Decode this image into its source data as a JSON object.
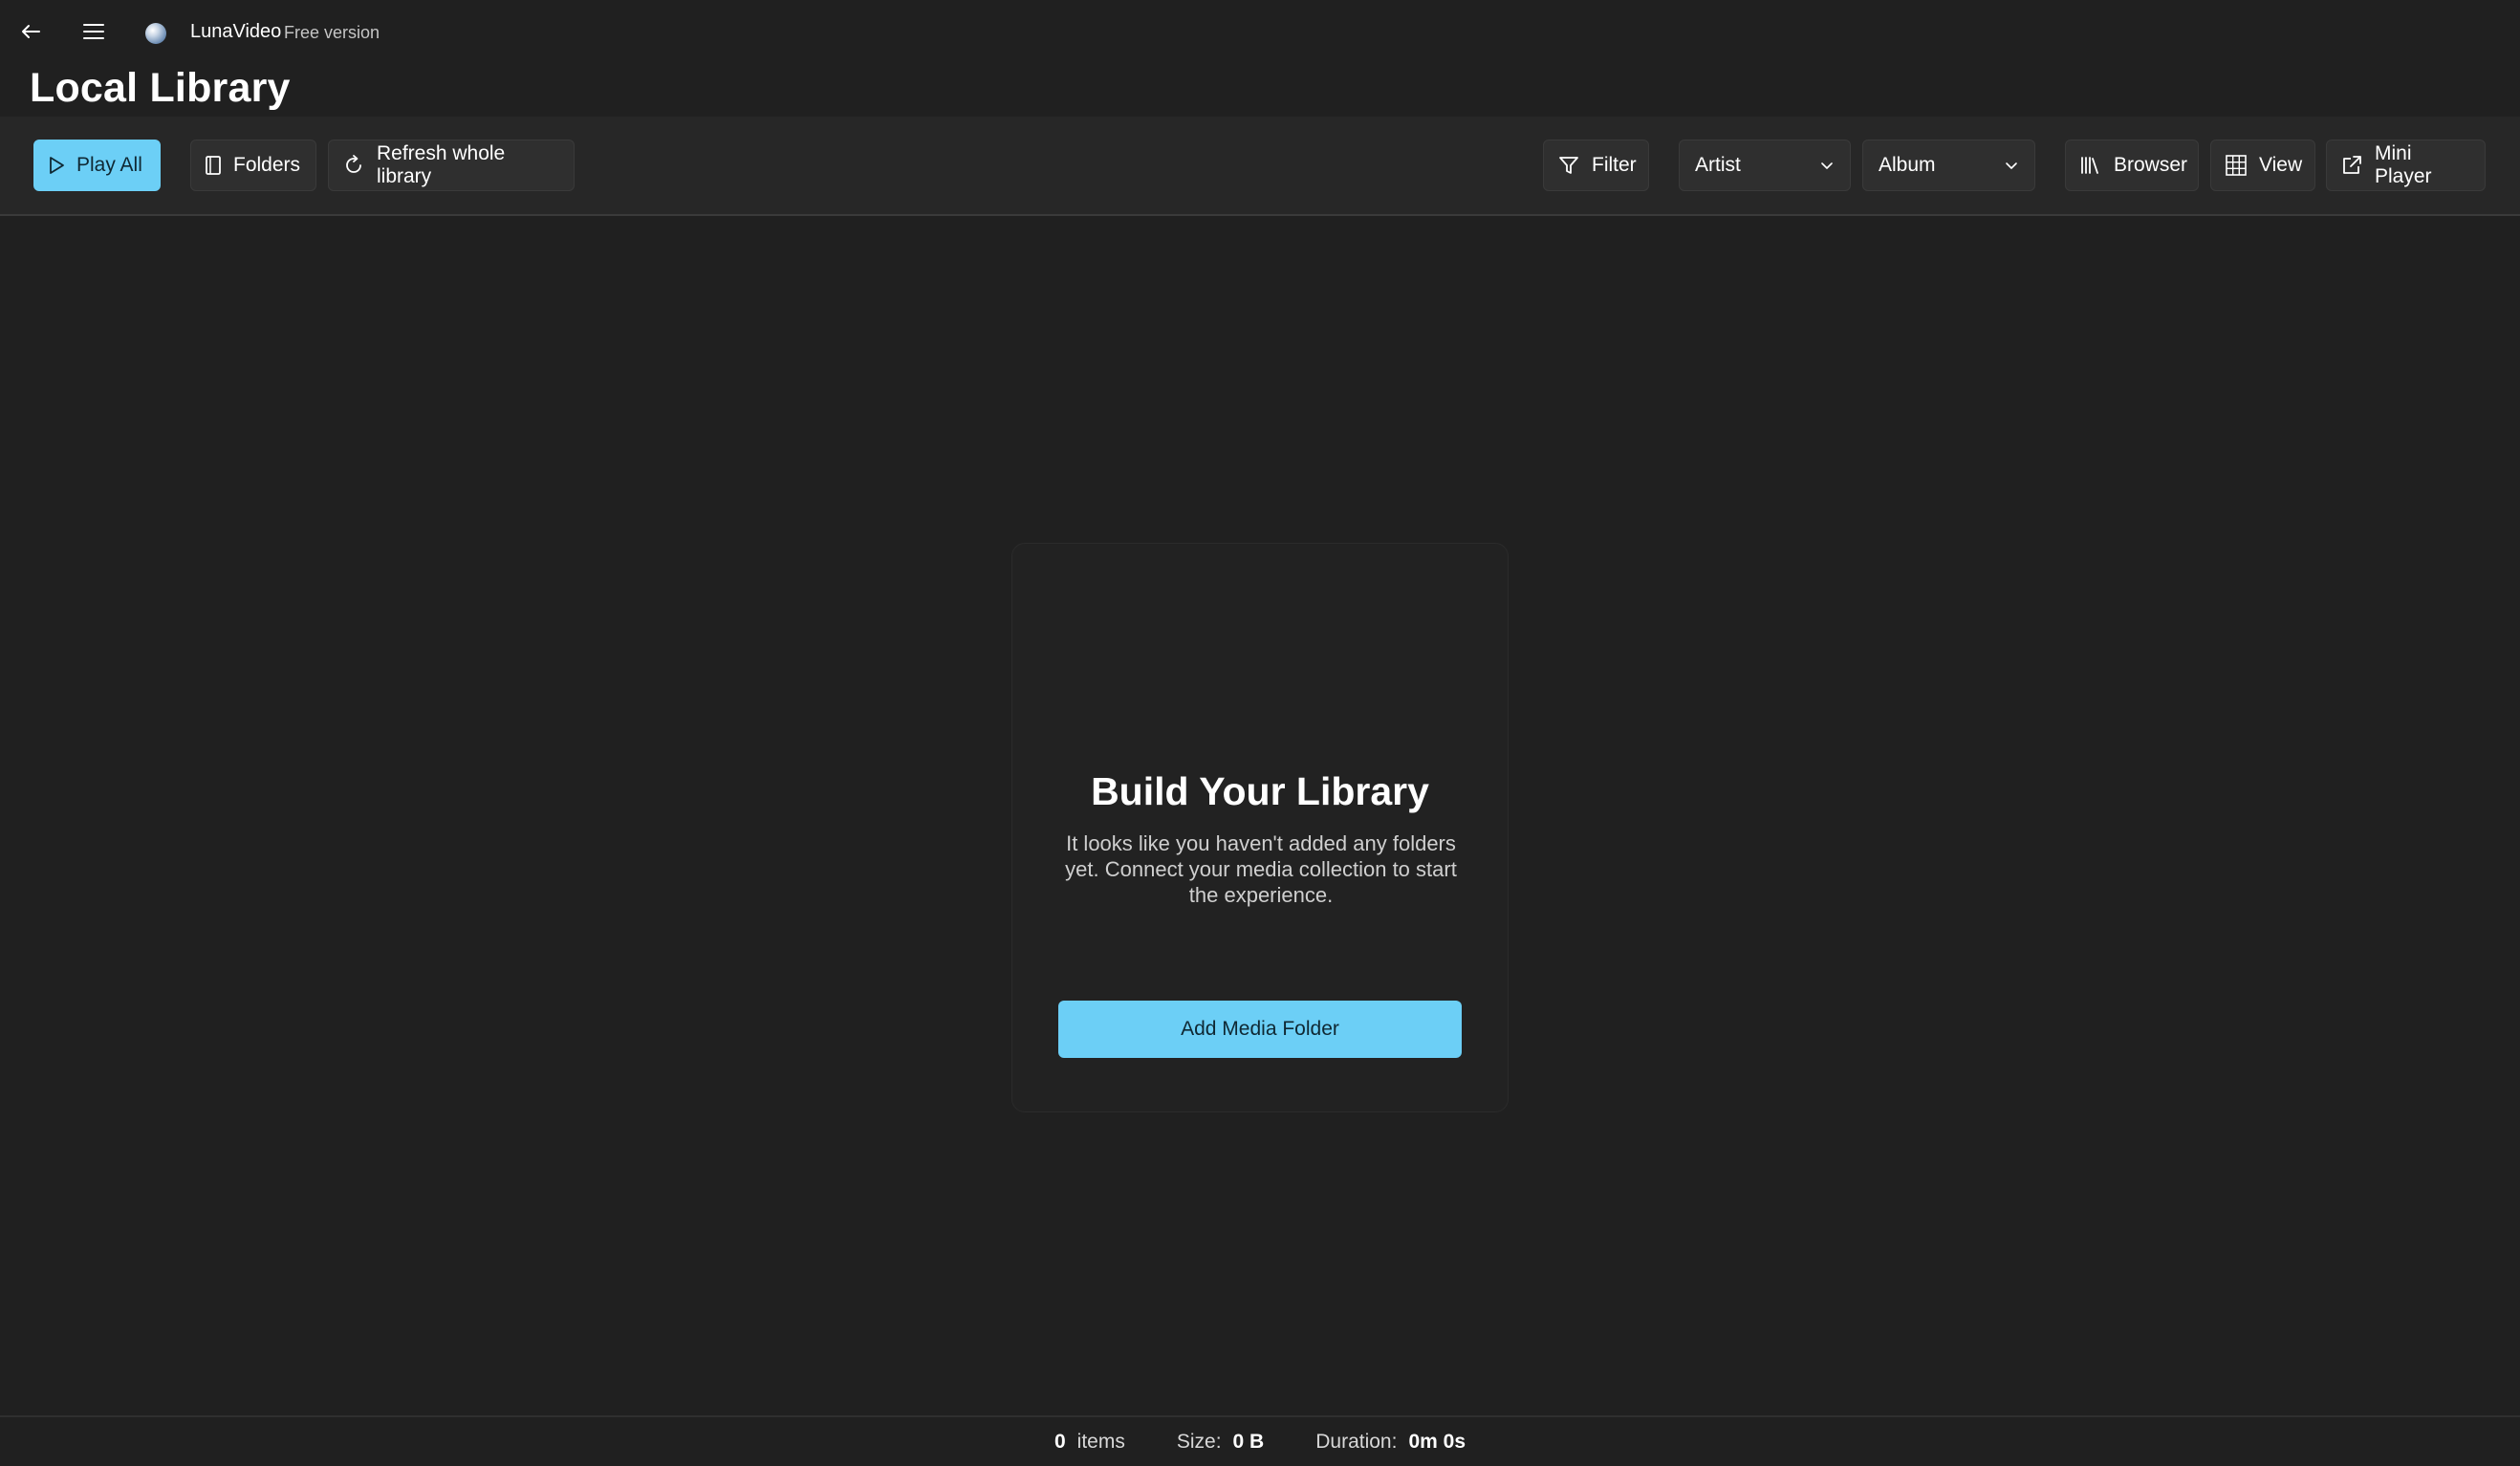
{
  "app": {
    "name": "LunaVideo",
    "edition": "Free version"
  },
  "page": {
    "title": "Local Library"
  },
  "toolbar": {
    "play_all": "Play All",
    "folders": "Folders",
    "refresh": "Refresh whole library",
    "filter": "Filter",
    "artist_selected": "Artist",
    "album_selected": "Album",
    "browser": "Browser",
    "view": "View",
    "mini_player": "Mini Player"
  },
  "empty_state": {
    "title": "Build Your Library",
    "description": "It looks like you haven't added any folders yet. Connect your media collection to start the experience.",
    "cta": "Add Media Folder"
  },
  "status": {
    "items_count": "0",
    "items_label": "items",
    "size_label": "Size:",
    "size_value": "0 B",
    "duration_label": "Duration:",
    "duration_value": "0m 0s"
  },
  "colors": {
    "accent": "#6ccff6",
    "background": "#202020",
    "toolbar": "#272727"
  },
  "icons": [
    "back-arrow-icon",
    "hamburger-menu-icon",
    "app-logo",
    "play-icon",
    "folder-icon",
    "refresh-icon",
    "filter-icon",
    "chevron-down-icon",
    "library-icon",
    "grid-icon",
    "popout-icon"
  ]
}
